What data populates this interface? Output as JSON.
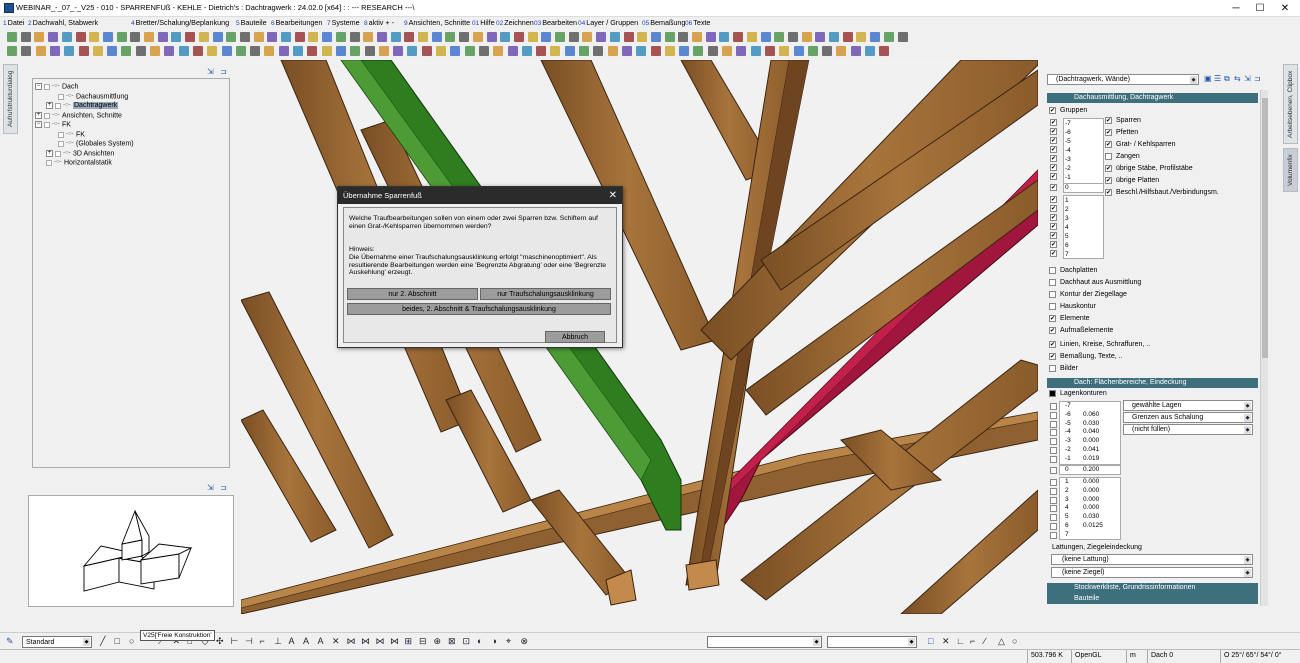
{
  "window": {
    "title": "WEBINAR_-_07_-_V25 - 010 - SPARRENFUß - KEHLE - Dietrich's : Dachtragwerk : 24.02.0 [x64] : : --- RESEARCH ---\\",
    "minimize": "─",
    "maximize": "☐",
    "close": "✕"
  },
  "menu": [
    {
      "num": "1",
      "label": "Datei"
    },
    {
      "num": "2",
      "label": "Dachwahl, Stabwerk"
    },
    {
      "num": "4",
      "label": "Bretter/Schalung/Beplankung"
    },
    {
      "num": "5",
      "label": "Bauteile"
    },
    {
      "num": "6",
      "label": "Bearbeitungen"
    },
    {
      "num": "7",
      "label": "Systeme"
    },
    {
      "num": "8",
      "label": "aktiv + -"
    },
    {
      "num": "9",
      "label": "Ansichten, Schnitte"
    },
    {
      "num": "01",
      "label": "Hilfe"
    },
    {
      "num": "02",
      "label": "Zeichnen"
    },
    {
      "num": "03",
      "label": "Bearbeiten"
    },
    {
      "num": "04",
      "label": "Layer / Gruppen"
    },
    {
      "num": "05",
      "label": "Bemaßung"
    },
    {
      "num": "06",
      "label": "Texte"
    }
  ],
  "left_strip": {
    "tab": "Aufrufstrukturdialog"
  },
  "tree": {
    "items": [
      {
        "label": "Dach"
      },
      {
        "label": "Dachausmittlung"
      },
      {
        "label": "Dachtragwerk"
      },
      {
        "label": "Ansichten, Schnitte"
      },
      {
        "label": "FK"
      },
      {
        "label": "FK"
      },
      {
        "label": "(Globales System)"
      },
      {
        "label": "3D Ansichten"
      },
      {
        "label": "Horizontalstatik"
      }
    ],
    "minus": "−",
    "plus": "+"
  },
  "right_strip": {
    "tab1": "Arbeitsebenen, Clipbox",
    "tab2": "Volumenfix"
  },
  "right_panel": {
    "combo_value": "(Dachtragwerk, Wände)",
    "section1": "Dachausmittlung, Dachtragwerk",
    "gruppen_label": "Gruppen",
    "gruppen_neg": [
      "-7",
      "-6",
      "-5",
      "-4",
      "-3",
      "-2",
      "-1"
    ],
    "gruppen_zero": "0",
    "gruppen_pos": [
      "1",
      "2",
      "3",
      "4",
      "5",
      "6",
      "7"
    ],
    "options_right": [
      {
        "label": "Sparren",
        "checked": true
      },
      {
        "label": "Pfetten",
        "checked": true
      },
      {
        "label": "Grat- / Kehlsparren",
        "checked": true
      },
      {
        "label": "Zangen",
        "checked": false
      },
      {
        "label": "übrige Stäbe, Profilstäbe",
        "checked": true
      },
      {
        "label": "übrige Platten",
        "checked": true
      },
      {
        "label": "Beschl./Hilfsbaut./Verbindungsm.",
        "checked": true
      }
    ],
    "options_list": [
      {
        "label": "Dachplatten",
        "checked": false
      },
      {
        "label": "Dachhaut aus Ausmittlung",
        "checked": false
      },
      {
        "label": "Kontur der Ziegellage",
        "checked": false
      },
      {
        "label": "Hauskontur",
        "checked": false
      },
      {
        "label": "Elemente",
        "checked": true
      },
      {
        "label": "Aufmaßelemente",
        "checked": true
      },
      {
        "label": "Linien, Kreise, Schraffuren, ..",
        "checked": true
      },
      {
        "label": "Bemaßung, Texte, ..",
        "checked": true
      },
      {
        "label": "Bilder",
        "checked": false
      }
    ],
    "section2": "Dach: Flächenbereiche, Eindeckung",
    "lagenkonturen_label": "Lagenkonturen",
    "lagen_neg": [
      {
        "idx": "-7",
        "val": ""
      },
      {
        "idx": "-6",
        "val": "0.060"
      },
      {
        "idx": "-5",
        "val": "0.030"
      },
      {
        "idx": "-4",
        "val": "0.040"
      },
      {
        "idx": "-3",
        "val": "0.000"
      },
      {
        "idx": "-2",
        "val": "0.041"
      },
      {
        "idx": "-1",
        "val": "0.019"
      }
    ],
    "lagen_zero": {
      "idx": "0",
      "val": "0.200"
    },
    "lagen_pos": [
      {
        "idx": "1",
        "val": "0.000"
      },
      {
        "idx": "2",
        "val": "0.000"
      },
      {
        "idx": "3",
        "val": "0.000"
      },
      {
        "idx": "4",
        "val": "0.000"
      },
      {
        "idx": "5",
        "val": "0.030"
      },
      {
        "idx": "6",
        "val": "0.0125"
      },
      {
        "idx": "7",
        "val": ""
      }
    ],
    "btn_gewaehlte": "gewählte Lagen",
    "btn_grenzen": "Grenzen aus Schalung",
    "btn_nicht": "(nicht füllen)",
    "lattungen_label": "Lattungen, Ziegeleindeckung",
    "keine_lattung": "(keine Lattung)",
    "keine_ziegel": "(keine Ziegel)",
    "section3": "Stockwerkliste, Grundrissinformationen",
    "section4": "Bauteile"
  },
  "dialog": {
    "title": "Übernahme Sparrenfuß",
    "close": "✕",
    "question": "Welche Traufbearbeitungen sollen von einem oder zwei Sparren bzw. Schiftern auf einen Grat-/Kehlsparren übernommen werden?",
    "hint_label": "Hinweis:",
    "hint": "Die Übernahme einer Traufschalungsausklinkung erfolgt \"maschinenoptimiert\". Als resultierende Bearbeitungen werden eine 'Begrenzte Abgratung' oder eine 'Begrenzte Auskehlung' erzeugt.",
    "btn1": "nur 2. Abschnitt",
    "btn2": "nur Traufschalungsausklinkung",
    "btn3": "beides, 2. Abschnitt & Traufschalungsausklinkung",
    "cancel": "Abbruch"
  },
  "bottom": {
    "style_combo": "Standard",
    "tooltip": "V25['Freie Konstruktion'"
  },
  "status": {
    "value1": "503.796 K",
    "value2": "OpenGL",
    "value3": "m",
    "value4": "Dach 0",
    "value5": "O 25°/ 65°/ 54°/ 0°"
  },
  "colors": {
    "accent_section": "#3d6f7d",
    "wood": "#9b6a35",
    "green": "#2e7d1e",
    "red": "#a0163c"
  }
}
